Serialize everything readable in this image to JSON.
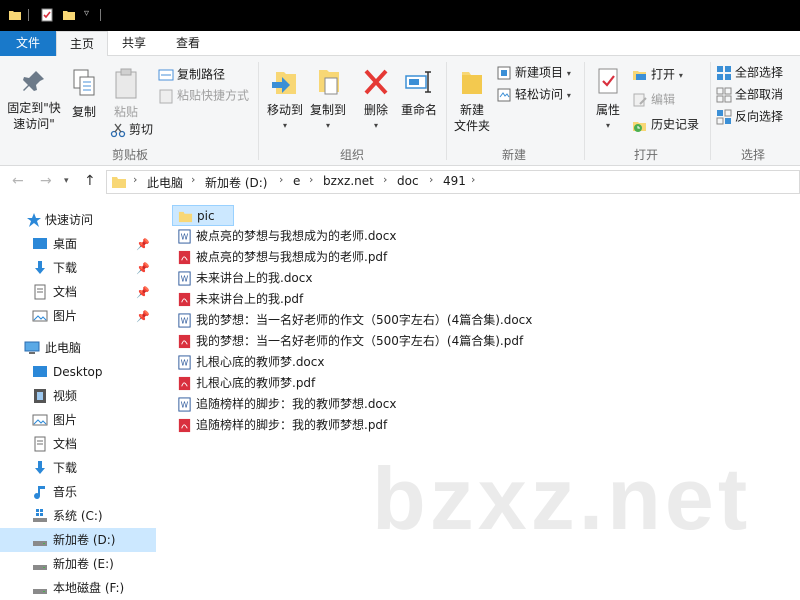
{
  "ribbon_tabs": [
    "文件",
    "主页",
    "共享",
    "查看"
  ],
  "clipboard": {
    "pin_label_1": "固定到\"快",
    "pin_label_2": "速访问\"",
    "copy": "复制",
    "paste": "粘贴",
    "copy_path": "复制路径",
    "paste_shortcut": "粘贴快捷方式",
    "cut": "剪切",
    "group": "剪贴板"
  },
  "organize": {
    "move_to": "移动到",
    "copy_to": "复制到",
    "delete": "删除",
    "rename": "重命名",
    "group": "组织"
  },
  "new": {
    "new_folder_1": "新建",
    "new_folder_2": "文件夹",
    "new_item": "新建项目",
    "easy_access": "轻松访问",
    "group": "新建"
  },
  "open": {
    "properties": "属性",
    "open": "打开",
    "edit": "编辑",
    "history": "历史记录",
    "group": "打开"
  },
  "select": {
    "select_all": "全部选择",
    "select_none": "全部取消",
    "invert": "反向选择",
    "group": "选择"
  },
  "breadcrumbs": [
    "此电脑",
    "新加卷 (D:)",
    "e",
    "bzxz.net",
    "doc",
    "491"
  ],
  "nav": {
    "quick_access": "快速访问",
    "desktop": "桌面",
    "downloads": "下载",
    "documents": "文档",
    "pictures": "图片",
    "this_pc": "此电脑",
    "pc_desktop": "Desktop",
    "videos": "视频",
    "pc_pictures": "图片",
    "pc_documents": "文档",
    "pc_downloads": "下载",
    "music": "音乐",
    "drive_c": "系统 (C:)",
    "drive_d": "新加卷 (D:)",
    "drive_e": "新加卷 (E:)",
    "drive_f": "本地磁盘 (F:)"
  },
  "files": [
    {
      "name": "pic",
      "type": "folder"
    },
    {
      "name": "被点亮的梦想与我想成为的老师.docx",
      "type": "docx"
    },
    {
      "name": "被点亮的梦想与我想成为的老师.pdf",
      "type": "pdf"
    },
    {
      "name": "未来讲台上的我.docx",
      "type": "docx"
    },
    {
      "name": "未来讲台上的我.pdf",
      "type": "pdf"
    },
    {
      "name": "我的梦想：当一名好老师的作文（500字左右）(4篇合集).docx",
      "type": "docx"
    },
    {
      "name": "我的梦想：当一名好老师的作文（500字左右）(4篇合集).pdf",
      "type": "pdf"
    },
    {
      "name": "扎根心底的教师梦.docx",
      "type": "docx"
    },
    {
      "name": "扎根心底的教师梦.pdf",
      "type": "pdf"
    },
    {
      "name": "追随榜样的脚步：我的教师梦想.docx",
      "type": "docx"
    },
    {
      "name": "追随榜样的脚步：我的教师梦想.pdf",
      "type": "pdf"
    }
  ],
  "watermark": "bzxz.net",
  "colors": {
    "accent": "#1979ca",
    "selection": "#cce8ff",
    "folder": "#f8d775",
    "pdf": "#d9303e",
    "word": "#2b579a"
  }
}
